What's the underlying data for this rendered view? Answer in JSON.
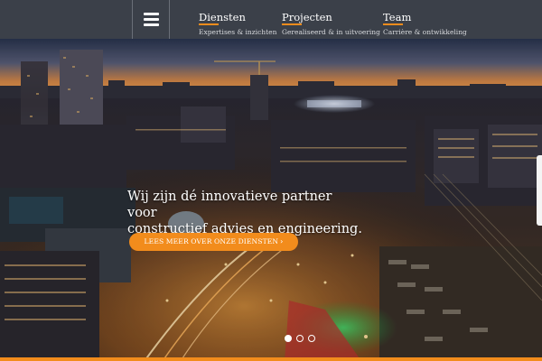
{
  "header": {
    "menu_icon": "hamburger-icon",
    "nav": [
      {
        "title": "Diensten",
        "subtitle": "Expertises & inzichten"
      },
      {
        "title": "Projecten",
        "subtitle": "Gerealiseerd & in uitvoering"
      },
      {
        "title": "Team",
        "subtitle": "Carrière & ontwikkeling"
      }
    ]
  },
  "hero": {
    "headline_line1": "Wij zijn dé innovatieve partner voor",
    "headline_line2": "constructief advies en engineering.",
    "cta_label": "LEES MEER OVER ONZE DIENSTEN",
    "cta_icon": "chevron-right-icon",
    "slides_total": 3,
    "slide_active": 1
  },
  "colors": {
    "accent": "#f28c1c",
    "header_bg": "#3b4049",
    "text_light": "#ffffff"
  }
}
